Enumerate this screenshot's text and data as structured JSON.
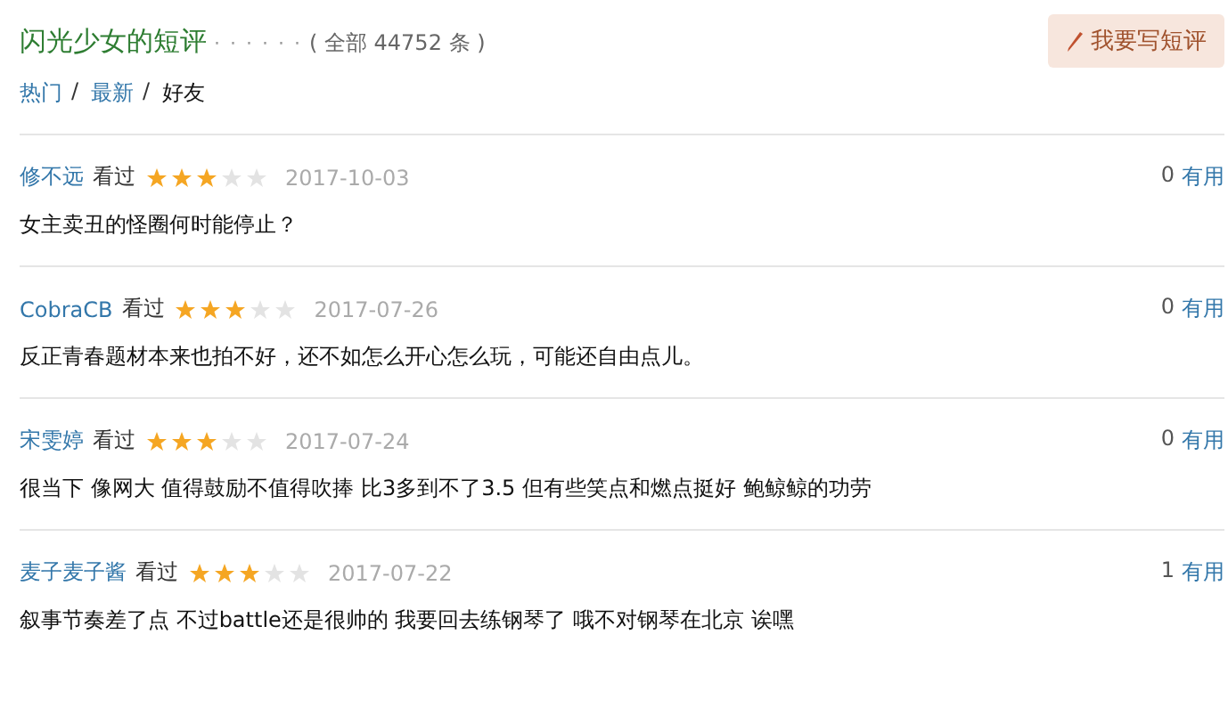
{
  "header": {
    "title": "闪光少女的短评",
    "dots": "· · · · · ·",
    "count": "( 全部 44752 条 )",
    "button": "我要写短评"
  },
  "tabs": [
    {
      "label": "热门",
      "selected": false,
      "separator": "/"
    },
    {
      "label": "最新",
      "selected": false,
      "separator": "/"
    },
    {
      "label": "好友",
      "selected": true
    }
  ],
  "comments": [
    {
      "user": "修不远",
      "status": "看过",
      "stars": 3,
      "date": "2017-10-03",
      "text": "女主卖丑的怪圈何时能停止？",
      "votes": "0",
      "vote_label": "有用"
    },
    {
      "user": "CobraCB",
      "status": "看过",
      "stars": 3,
      "date": "2017-07-26",
      "text": "反正青春题材本来也拍不好，还不如怎么开心怎么玩，可能还自由点儿。",
      "votes": "0",
      "vote_label": "有用"
    },
    {
      "user": "宋雯婷",
      "status": "看过",
      "stars": 3,
      "date": "2017-07-24",
      "text": "很当下 像网大 值得鼓励不值得吹捧 比3多到不了3.5 但有些笑点和燃点挺好 鲍鲸鲸的功劳",
      "votes": "0",
      "vote_label": "有用"
    },
    {
      "user": "麦子麦子酱",
      "status": "看过",
      "stars": 3,
      "date": "2017-07-22",
      "text": "叙事节奏差了点 不过battle还是很帅的 我要回去练钢琴了 哦不对钢琴在北京 诶嘿",
      "votes": "1",
      "vote_label": "有用"
    }
  ]
}
